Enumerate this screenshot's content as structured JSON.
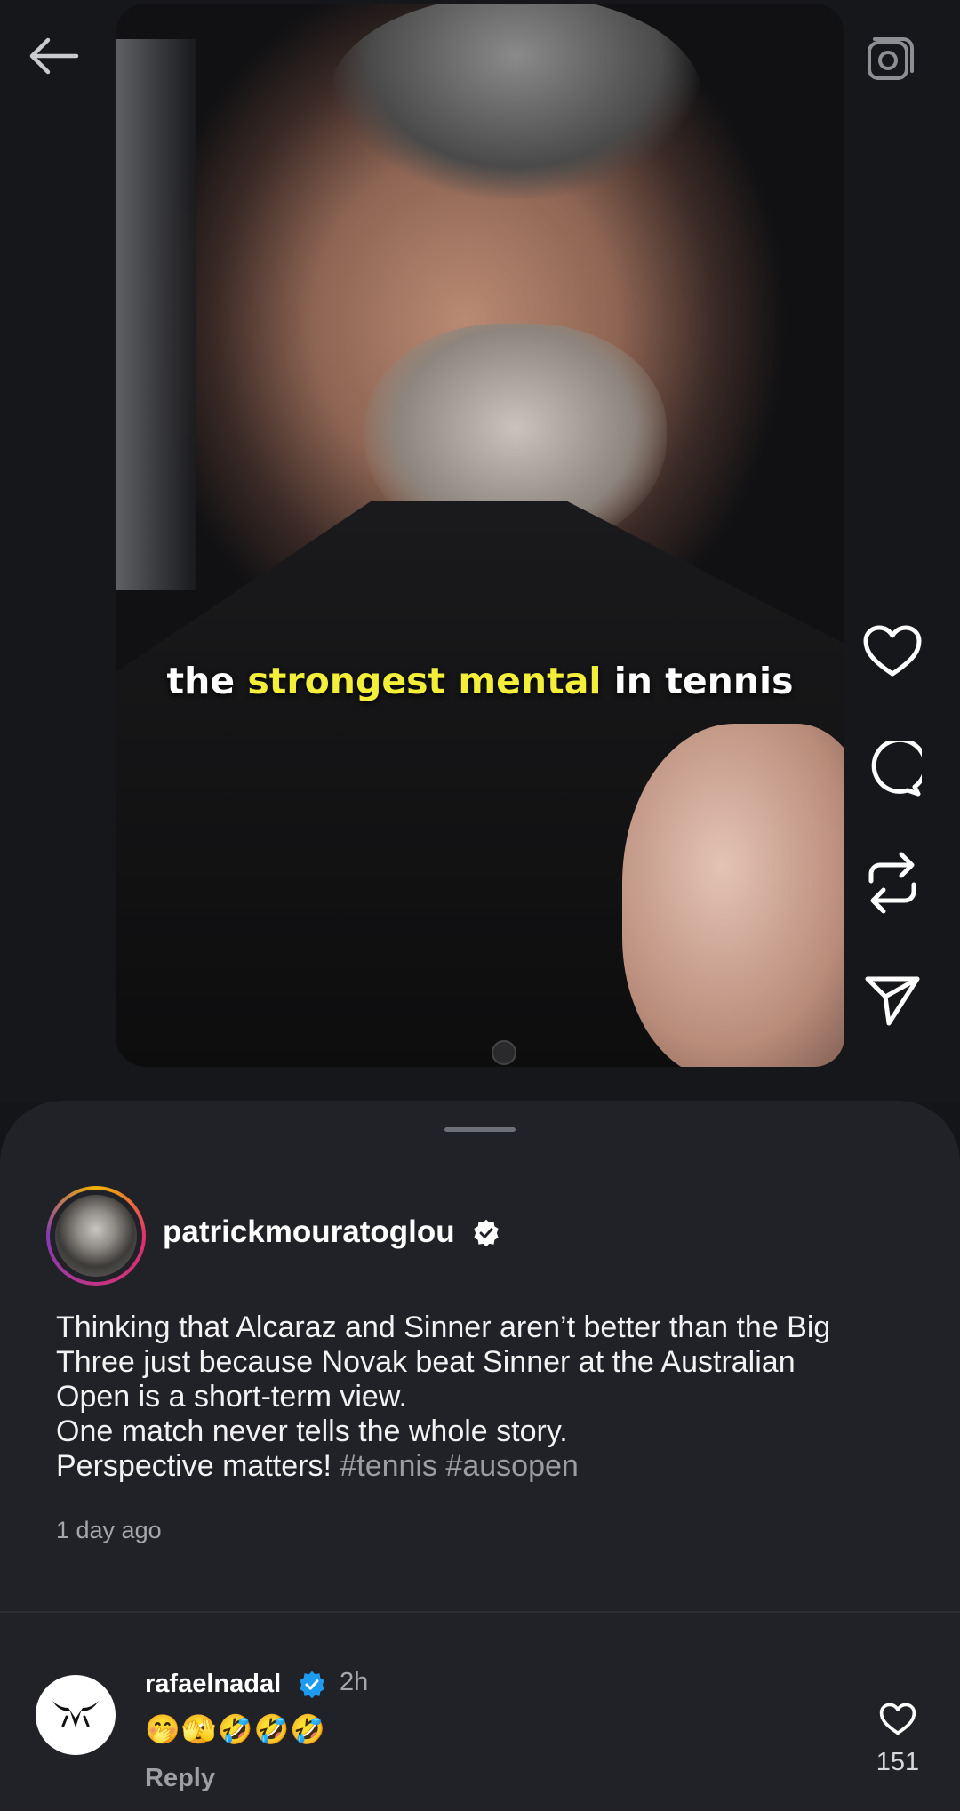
{
  "video": {
    "caption_pre": "the ",
    "caption_highlight": "strongest mental",
    "caption_post": " in tennis",
    "highlight_color": "#f2ee3a"
  },
  "nav": {
    "back_icon": "back-arrow-icon",
    "camera_icon": "camera-icon"
  },
  "actions": {
    "like_icon": "heart-icon",
    "comment_icon": "comment-icon",
    "repost_icon": "repost-icon",
    "share_icon": "send-icon"
  },
  "post": {
    "author": "patrickmouratoglou",
    "lines": [
      "Thinking that Alcaraz and Sinner aren’t better than the Big",
      "Three just because Novak beat Sinner at the Australian",
      "Open is a short-term view.",
      "One match never tells the whole story."
    ],
    "last_line_text": "Perspective matters! ",
    "hashtags": "#tennis #ausopen",
    "time": "1 day ago"
  },
  "comment": {
    "author": "rafaelnadal",
    "time": "2h",
    "text": "🤭🫣🤣🤣🤣",
    "reply_label": "Reply",
    "like_count": "151",
    "verified_color": "#1d9bf0"
  }
}
